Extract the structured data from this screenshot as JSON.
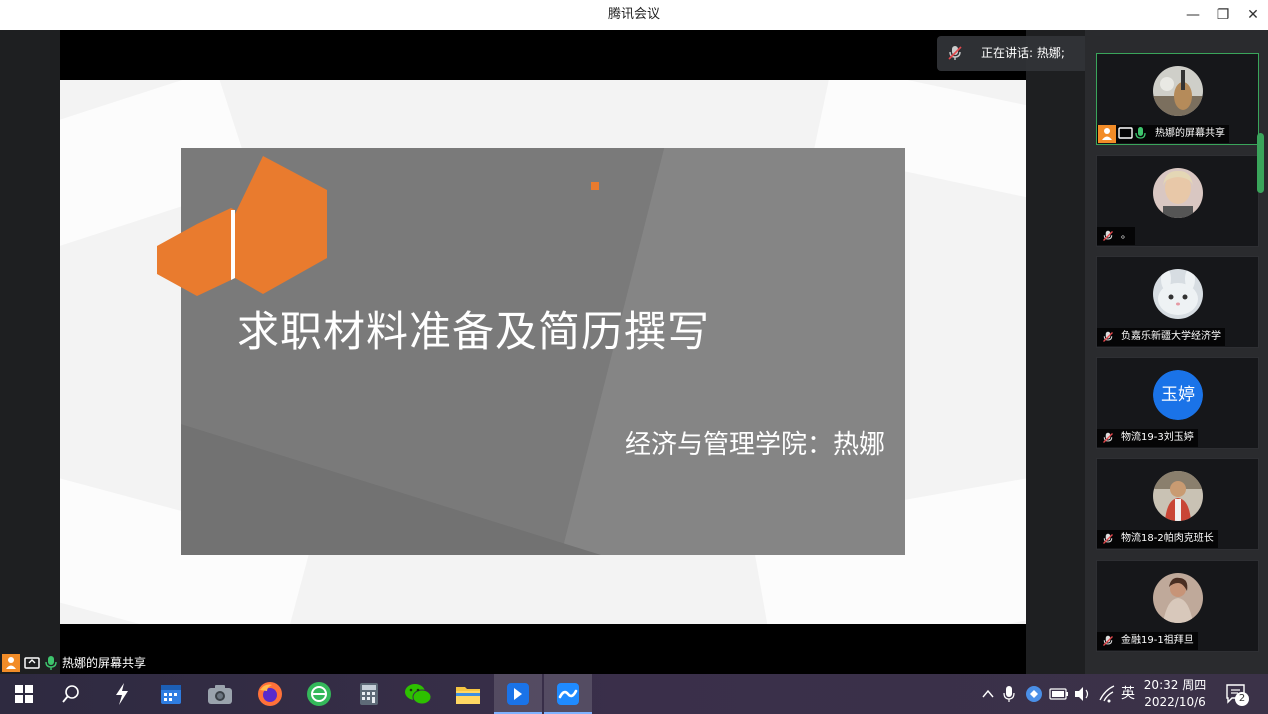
{
  "window": {
    "title": "腾讯会议",
    "min_glyph": "—",
    "max_glyph": "❐",
    "close_glyph": "✕"
  },
  "slide": {
    "title": "求职材料准备及简历撰写",
    "subtitle": "经济与管理学院：热娜",
    "accent_color": "#e97b2e"
  },
  "speaking": {
    "text": "正在讲话: 热娜;"
  },
  "participants": [
    {
      "name": "热娜的屏幕共享",
      "avatar": "photo-guitar",
      "active": true
    },
    {
      "name": "。",
      "avatar": "photo-woman"
    },
    {
      "name": "负嘉乐新疆大学经济学",
      "avatar": "cat-cartoon"
    },
    {
      "name": "物流19-3刘玉婷",
      "avatar_text": "玉婷",
      "avatar": "text-avatar"
    },
    {
      "name": "物流18-2帕肉克班长",
      "avatar": "photo-person"
    },
    {
      "name": "金融19-1祖拜旦",
      "avatar": "photo-person-2"
    }
  ],
  "share_bar": {
    "label": "热娜的屏幕共享"
  },
  "taskbar": {
    "apps": [
      "start-icon",
      "search-icon",
      "speed-icon",
      "calendar-icon",
      "camera-icon",
      "firefox-icon",
      "browser-icon",
      "calculator-icon",
      "wechat-icon",
      "folder-icon",
      "pin-icon",
      "tencent-meeting-icon"
    ],
    "ime": "英",
    "time": "20:32 周四",
    "date": "2022/10/6",
    "notifications": "2"
  }
}
